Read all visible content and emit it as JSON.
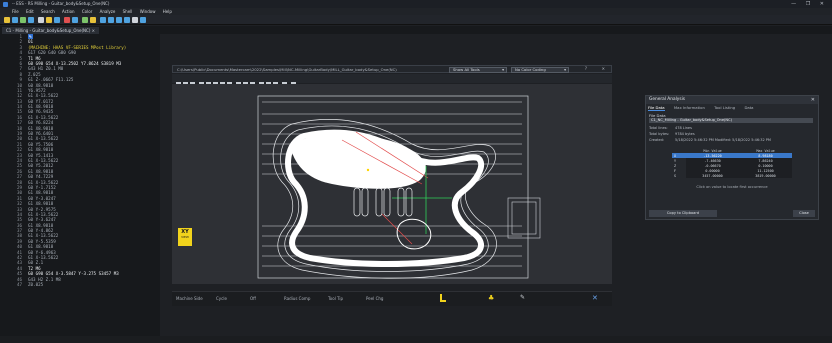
{
  "app": {
    "title": "-- ESS - RS Milling - Guitar_body&Setup_One(NC)",
    "window_controls": "— ❐ ✕"
  },
  "menu": [
    "File",
    "Edit",
    "Search",
    "Action",
    "Color",
    "Analyze",
    "Shell",
    "Window",
    "Help"
  ],
  "doc_tab": "C1 - Milling - Guitar_body&Setup_One(NC) ×",
  "code_lines": [
    {
      "num": "1",
      "text": "%",
      "style": "hl"
    },
    {
      "num": "2",
      "text": "O1",
      "style": "w"
    },
    {
      "num": "3",
      "text": "(MACHINE: HAAS VF-SERIES MPost Library)",
      "style": "y"
    },
    {
      "num": "4",
      "text": "G17 G20 G40 G80 G90",
      "style": "n"
    },
    {
      "num": "5",
      "text": "T1 M6",
      "style": "w"
    },
    {
      "num": "6",
      "text": "G0 G90 G54 X-13.2502 Y7.8624 S3819 M3",
      "style": "w"
    },
    {
      "num": "7",
      "text": "G43 H1 Z0.1 M8",
      "style": "n"
    },
    {
      "num": "8",
      "text": "Z.025",
      "style": "n"
    },
    {
      "num": "9",
      "text": "G1 Z-.0667 F11.125",
      "style": "n"
    },
    {
      "num": "10",
      "text": "G0 X8.9818",
      "style": "n"
    },
    {
      "num": "11",
      "text": "Y6.9572",
      "style": "n"
    },
    {
      "num": "12",
      "text": "G1 X-13.5622",
      "style": "n"
    },
    {
      "num": "13",
      "text": "G0 Y7.0172",
      "style": "n"
    },
    {
      "num": "14",
      "text": "G1 X8.9818",
      "style": "n"
    },
    {
      "num": "15",
      "text": "G0 Y6.9435",
      "style": "n"
    },
    {
      "num": "16",
      "text": "G1 X-13.5622",
      "style": "n"
    },
    {
      "num": "17",
      "text": "G0 Y6.8224",
      "style": "n"
    },
    {
      "num": "18",
      "text": "G1 X8.9818",
      "style": "n"
    },
    {
      "num": "19",
      "text": "G0 Y6.6401",
      "style": "n"
    },
    {
      "num": "20",
      "text": "G1 X-13.5622",
      "style": "n"
    },
    {
      "num": "21",
      "text": "G0 Y5.7506",
      "style": "n"
    },
    {
      "num": "22",
      "text": "G1 X8.9818",
      "style": "n"
    },
    {
      "num": "23",
      "text": "G0 Y5.1413",
      "style": "n"
    },
    {
      "num": "24",
      "text": "G1 X-13.5622",
      "style": "n"
    },
    {
      "num": "25",
      "text": "G0 Y5.2012",
      "style": "n"
    },
    {
      "num": "26",
      "text": "G1 X8.9818",
      "style": "n"
    },
    {
      "num": "27",
      "text": "G0 Y4.7229",
      "style": "n"
    },
    {
      "num": "28",
      "text": "G1 X-13.5622",
      "style": "n"
    },
    {
      "num": "29",
      "text": "G0 Y-1.7152",
      "style": "n"
    },
    {
      "num": "30",
      "text": "G1 X8.9818",
      "style": "n"
    },
    {
      "num": "31",
      "text": "G0 Y-3.0247",
      "style": "n"
    },
    {
      "num": "32",
      "text": "G1 X8.9818",
      "style": "n"
    },
    {
      "num": "33",
      "text": "G0 Y-2.9575",
      "style": "n"
    },
    {
      "num": "34",
      "text": "G1 X-13.5622",
      "style": "n"
    },
    {
      "num": "35",
      "text": "G0 Y-3.6247",
      "style": "n"
    },
    {
      "num": "36",
      "text": "G1 X8.9818",
      "style": "n"
    },
    {
      "num": "37",
      "text": "G0 Y-4.862",
      "style": "n"
    },
    {
      "num": "38",
      "text": "G1 X-13.5622",
      "style": "n"
    },
    {
      "num": "39",
      "text": "G0 Y-5.5359",
      "style": "n"
    },
    {
      "num": "40",
      "text": "G1 X8.9818",
      "style": "n"
    },
    {
      "num": "41",
      "text": "G0 Y-6.4963",
      "style": "n"
    },
    {
      "num": "42",
      "text": "G1 X-13.5622",
      "style": "n"
    },
    {
      "num": "43",
      "text": "G0 Z.1",
      "style": "n"
    },
    {
      "num": "44",
      "text": "T2 M6",
      "style": "w"
    },
    {
      "num": "45",
      "text": "G0 G90 G54 X-3.5847 Y-3.275 S3457 M3",
      "style": "w"
    },
    {
      "num": "46",
      "text": "G43 H2 Z.1 M8",
      "style": "n"
    },
    {
      "num": "47",
      "text": "Z0.025",
      "style": "n"
    }
  ],
  "viewer": {
    "path": "C:\\Users\\Public\\Documents\\Mastercam\\2022\\Samples\\Mill\\NC-Milling\\GuitarBody\\MILL_Guitar_body&Setup_One(NC)",
    "filter_label": "Show All Tools",
    "color_label": "No Color Coding",
    "axes_badge": "XY",
    "axes_sub": "VIEW"
  },
  "status": [
    "Machine Side",
    "Cycle",
    "Off",
    "Radius Comp",
    "Tool Tip",
    "Peel Chg"
  ],
  "analysis": {
    "title": "General Analysis",
    "tabs": [
      "File Data",
      "Max Information",
      "Tool Listing",
      "Data"
    ],
    "section": "File Data",
    "file_name": "C1_NC_Milling - Guitar_body&Setup_One(NC)",
    "rows": [
      {
        "k": "Total lines:",
        "v": "478 Lines"
      },
      {
        "k": "Total bytes:",
        "v": "9784 bytes"
      },
      {
        "k": "Created:",
        "v": "5/18/2022 5:46:32 PM        Modified: 5/18/2022 5:46:32 PM"
      }
    ],
    "table_headers": [
      "",
      "Min Value",
      "Max Value"
    ],
    "table_rows": [
      {
        "axis": "X",
        "min": "-13.56220",
        "max": "8.98180"
      },
      {
        "axis": "Y",
        "min": "-7.46630",
        "max": "7.86240"
      },
      {
        "axis": "Z",
        "min": "-0.06670",
        "max": "0.10000"
      },
      {
        "axis": "F",
        "min": "0.00000",
        "max": "11.12500"
      },
      {
        "axis": "S",
        "min": "3457.00000",
        "max": "3819.00000"
      }
    ],
    "note": "Click on value to locate first occurrence",
    "copy_button": "Copy to Clipboard",
    "close_button": "Close"
  },
  "colors": {
    "accent": "#3a78c9",
    "yellow": "#e8d43a",
    "badge": "#f1d31c",
    "path_red": "#e24b4b",
    "path_green": "#2fd05a"
  }
}
